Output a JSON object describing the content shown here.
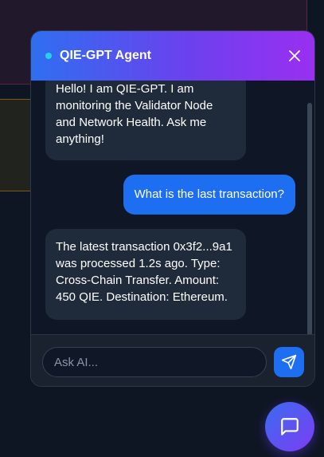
{
  "chat": {
    "title": "QIE-GPT Agent",
    "messages": [
      {
        "role": "bot",
        "text": "Hello! I am QIE-GPT. I am monitoring the Validator Node and Network Health. Ask me anything!"
      },
      {
        "role": "user",
        "text": "What is the last transaction?"
      },
      {
        "role": "bot",
        "text": "The latest transaction 0x3f2...9a1 was processed 1.2s ago. Type: Cross-Chain Transfer. Amount: 450 QIE. Destination: Ethereum."
      }
    ],
    "input": {
      "value": "",
      "placeholder": "Ask AI..."
    }
  },
  "icons": {
    "close": "close-icon",
    "send": "send-icon",
    "fab": "chat-bubble-icon",
    "status": "status-dot"
  },
  "colors": {
    "accent_blue": "#1e6ef2",
    "accent_purple": "#9a2ff1",
    "status_dot": "#22d3ee",
    "background": "#0f1623"
  }
}
